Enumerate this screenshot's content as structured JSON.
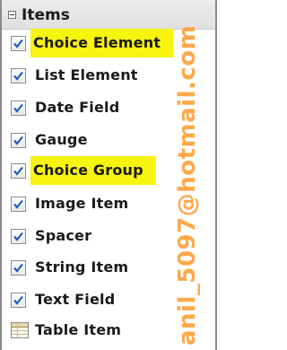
{
  "section": {
    "title": "Items",
    "collapse_symbol": "−"
  },
  "items": [
    {
      "label": "Choice Element",
      "icon": "checkbox-checked-icon",
      "highlighted": true
    },
    {
      "label": "List Element",
      "icon": "checkbox-checked-icon",
      "highlighted": false
    },
    {
      "label": "Date Field",
      "icon": "checkbox-checked-icon",
      "highlighted": false
    },
    {
      "label": "Gauge",
      "icon": "checkbox-checked-icon",
      "highlighted": false
    },
    {
      "label": "Choice Group",
      "icon": "checkbox-checked-icon",
      "highlighted": true
    },
    {
      "label": "Image Item",
      "icon": "checkbox-checked-icon",
      "highlighted": false
    },
    {
      "label": "Spacer",
      "icon": "checkbox-checked-icon",
      "highlighted": false
    },
    {
      "label": "String Item",
      "icon": "checkbox-checked-icon",
      "highlighted": false
    },
    {
      "label": "Text Field",
      "icon": "checkbox-checked-icon",
      "highlighted": false
    },
    {
      "label": "Table Item",
      "icon": "table-icon",
      "highlighted": false
    }
  ],
  "watermark": "anil_5097@hotmail.com",
  "colors": {
    "highlight": "#f7f40d",
    "watermark": "#ff9a2b",
    "checkmark": "#1c5fb8"
  }
}
